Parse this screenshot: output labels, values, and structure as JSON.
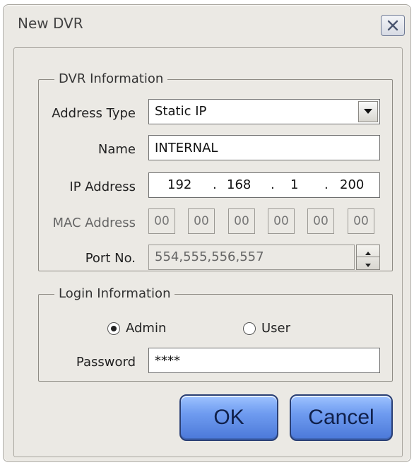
{
  "window": {
    "title": "New DVR"
  },
  "dvr_info": {
    "legend": "DVR Information",
    "address_type": {
      "label": "Address Type",
      "value": "Static IP"
    },
    "name": {
      "label": "Name",
      "value": "INTERNAL"
    },
    "ip_address": {
      "label": "IP Address",
      "octets": [
        "192",
        "168",
        "1",
        "200"
      ]
    },
    "mac_address": {
      "label": "MAC Address",
      "octets": [
        "00",
        "00",
        "00",
        "00",
        "00",
        "00"
      ]
    },
    "port": {
      "label": "Port No.",
      "value": "554,555,556,557"
    }
  },
  "login_info": {
    "legend": "Login Information",
    "radio_admin": "Admin",
    "radio_user": "User",
    "selected": "Admin",
    "password": {
      "label": "Password",
      "value": "****"
    }
  },
  "buttons": {
    "ok": "OK",
    "cancel": "Cancel"
  }
}
